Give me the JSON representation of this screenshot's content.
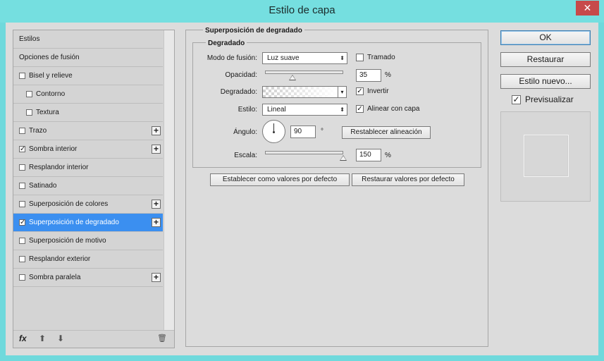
{
  "window": {
    "title": "Estilo de capa",
    "close_glyph": "✕"
  },
  "styles_panel": {
    "items": [
      {
        "label": "Estilos",
        "has_checkbox": false,
        "checked": false,
        "indent": 0,
        "has_plus": false,
        "selected": false
      },
      {
        "label": "Opciones de fusión",
        "has_checkbox": false,
        "checked": false,
        "indent": 0,
        "has_plus": false,
        "selected": false
      },
      {
        "label": "Bisel y relieve",
        "has_checkbox": true,
        "checked": false,
        "indent": 0,
        "has_plus": false,
        "selected": false
      },
      {
        "label": "Contorno",
        "has_checkbox": true,
        "checked": false,
        "indent": 1,
        "has_plus": false,
        "selected": false
      },
      {
        "label": "Textura",
        "has_checkbox": true,
        "checked": false,
        "indent": 1,
        "has_plus": false,
        "selected": false
      },
      {
        "label": "Trazo",
        "has_checkbox": true,
        "checked": false,
        "indent": 0,
        "has_plus": true,
        "selected": false
      },
      {
        "label": "Sombra interior",
        "has_checkbox": true,
        "checked": true,
        "indent": 0,
        "has_plus": true,
        "selected": false
      },
      {
        "label": "Resplandor interior",
        "has_checkbox": true,
        "checked": false,
        "indent": 0,
        "has_plus": false,
        "selected": false
      },
      {
        "label": "Satinado",
        "has_checkbox": true,
        "checked": false,
        "indent": 0,
        "has_plus": false,
        "selected": false
      },
      {
        "label": "Superposición de colores",
        "has_checkbox": true,
        "checked": false,
        "indent": 0,
        "has_plus": true,
        "selected": false
      },
      {
        "label": "Superposición de degradado",
        "has_checkbox": true,
        "checked": true,
        "indent": 0,
        "has_plus": true,
        "selected": true
      },
      {
        "label": "Superposición de motivo",
        "has_checkbox": true,
        "checked": false,
        "indent": 0,
        "has_plus": false,
        "selected": false
      },
      {
        "label": "Resplandor exterior",
        "has_checkbox": true,
        "checked": false,
        "indent": 0,
        "has_plus": false,
        "selected": false
      },
      {
        "label": "Sombra paralela",
        "has_checkbox": true,
        "checked": false,
        "indent": 0,
        "has_plus": true,
        "selected": false
      }
    ],
    "footer": {
      "fx_label": "fx",
      "up_arrow_glyph": "⬆",
      "down_arrow_glyph": "⬇",
      "trash_glyph": "🗑"
    }
  },
  "settings": {
    "group_title": "Superposición de degradado",
    "inner_title": "Degradado",
    "blend_mode": {
      "label": "Modo de fusión:",
      "value": "Luz suave"
    },
    "dither": {
      "label": "Tramado",
      "checked": false
    },
    "opacity": {
      "label": "Opacidad:",
      "value": "35",
      "unit": "%",
      "level": 0.35
    },
    "gradient": {
      "label": "Degradado:"
    },
    "reverse": {
      "label": "Invertir",
      "checked": true
    },
    "style": {
      "label": "Estilo:",
      "value": "Lineal"
    },
    "align_with_layer": {
      "label": "Alinear con capa",
      "checked": true
    },
    "angle": {
      "label": "Ángulo:",
      "value": "90",
      "unit": "°"
    },
    "reset_alignment": "Restablecer alineación",
    "scale": {
      "label": "Escala:",
      "value": "150",
      "unit": "%",
      "level": 1.0
    },
    "make_default": "Establecer como valores por defecto",
    "reset_default": "Restaurar valores por defecto"
  },
  "actions": {
    "ok": "OK",
    "reset": "Restaurar",
    "new_style": "Estilo nuevo...",
    "preview": {
      "label": "Previsualizar",
      "checked": true
    }
  },
  "colors": {
    "titlebar": "#75dfe0",
    "selection": "#3b8ff0",
    "close": "#c74a4a"
  },
  "check_glyph": "✓",
  "plus_glyph": "+",
  "select_arrow_glyph": "⬍",
  "dropdown_glyph": "▾"
}
